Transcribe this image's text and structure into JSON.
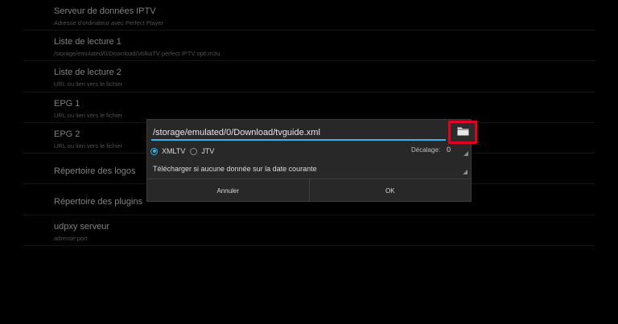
{
  "settings": {
    "items": [
      {
        "title": "Serveur de données IPTV",
        "subtitle": "Adresse d'ordinateur avec Perfect Player"
      },
      {
        "title": "Liste de lecture 1",
        "subtitle": "/storage/emulated/0/Download/VolkaTV perfect IPTV opti.m3u"
      },
      {
        "title": "Liste de lecture 2",
        "subtitle": "URL ou lien vers le fichier"
      },
      {
        "title": "EPG 1",
        "subtitle": "URL ou lien vers le fichier"
      },
      {
        "title": "EPG 2",
        "subtitle": "URL ou lien vers le fichier"
      },
      {
        "title": "Répertoire des logos",
        "subtitle": ""
      },
      {
        "title": "Répertoire des plugins",
        "subtitle": ""
      },
      {
        "title": "udpxy serveur",
        "subtitle": "adresse:port"
      }
    ]
  },
  "dialog": {
    "path_value": "/storage/emulated/0/Download/tvguide.xml",
    "folder_icon": "folder-icon",
    "format_options": [
      "XMLTV",
      "JTV"
    ],
    "format_selected": "XMLTV",
    "offset_label": "Décalage:",
    "offset_value": "0",
    "download_option": "Télécharger si aucune donnée sur la date courante",
    "cancel_label": "Annuler",
    "ok_label": "OK"
  },
  "colors": {
    "accent": "#33b5e5",
    "highlight": "#e5001c",
    "background": "#000000",
    "dialog_bg": "#282828"
  }
}
